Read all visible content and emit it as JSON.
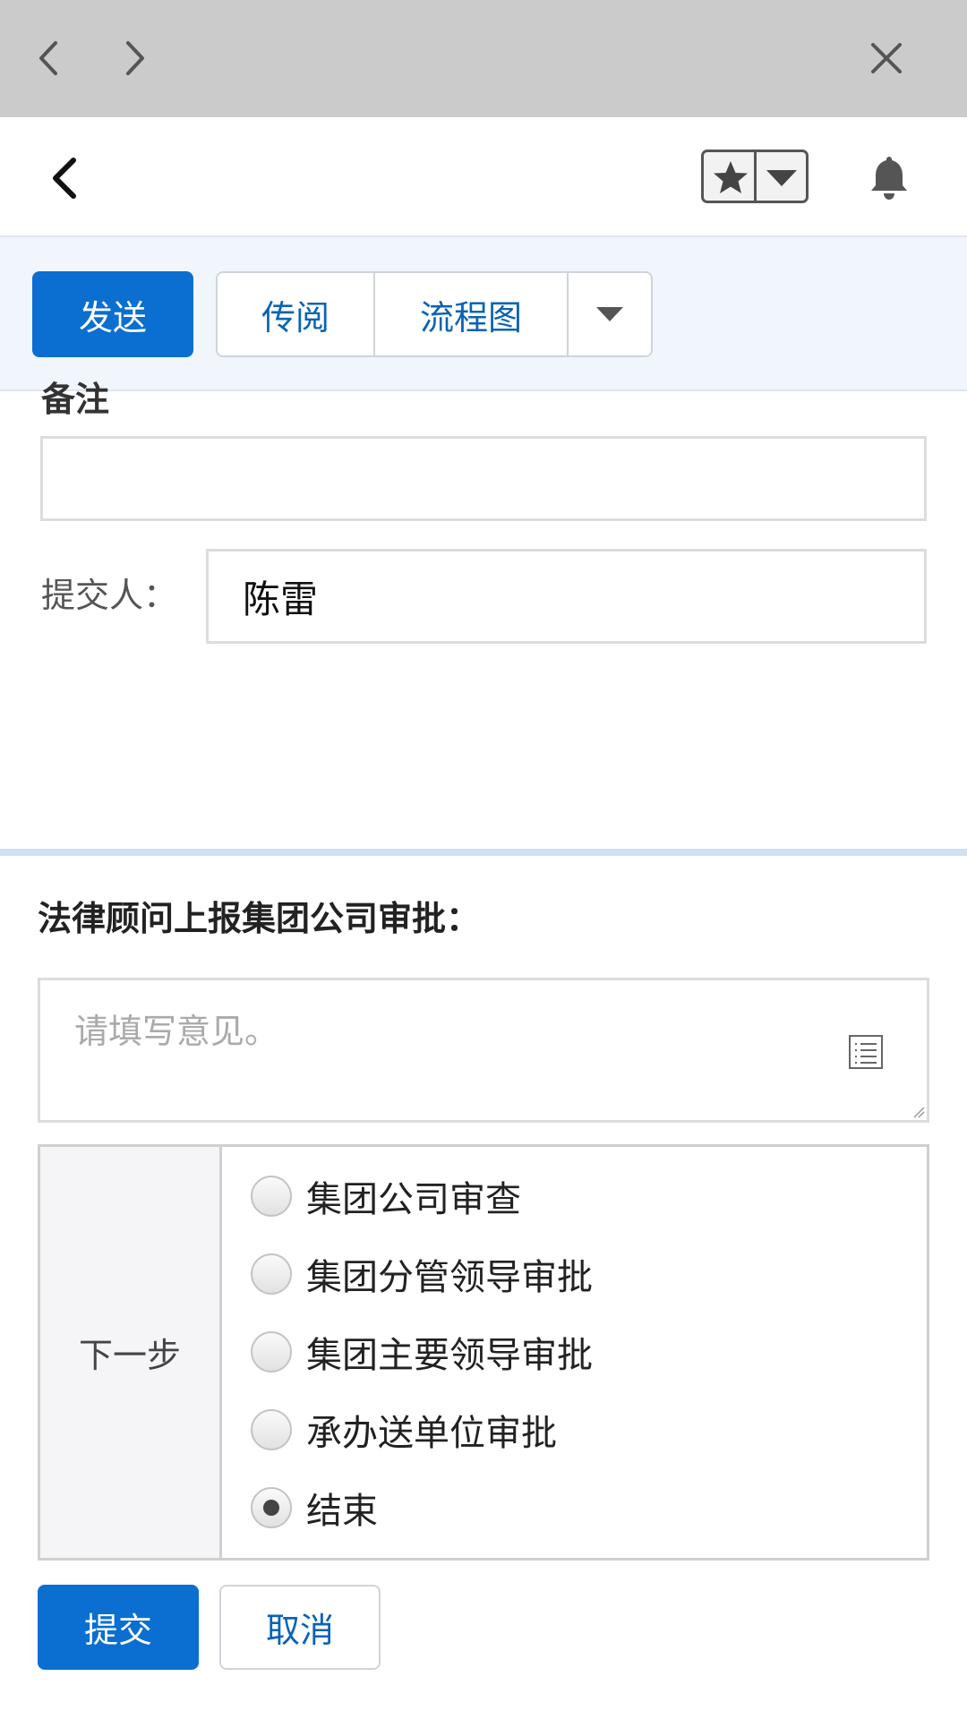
{
  "toolbar": {
    "send_label": "发送",
    "circulate_label": "传阅",
    "flowchart_label": "流程图"
  },
  "form": {
    "remark_label": "备注",
    "remark_value": "",
    "submitter_label": "提交人：",
    "submitter_value": "陈雷"
  },
  "approval": {
    "title": "法律顾问上报集团公司审批：",
    "opinion_placeholder": "请填写意见。",
    "next_step_label": "下一步",
    "options": [
      {
        "label": "集团公司审查",
        "checked": false
      },
      {
        "label": "集团分管领导审批",
        "checked": false
      },
      {
        "label": "集团主要领导审批",
        "checked": false
      },
      {
        "label": "承办送单位审批",
        "checked": false
      },
      {
        "label": "结束",
        "checked": true
      }
    ]
  },
  "actions": {
    "submit_label": "提交",
    "cancel_label": "取消"
  },
  "icons": {
    "nav_back": "chevron-left-icon",
    "nav_forward": "chevron-right-icon",
    "close": "close-icon",
    "page_back": "back-icon",
    "favorite": "star-icon",
    "favorite_dropdown": "caret-down-icon",
    "notifications": "bell-icon",
    "more": "caret-down-icon",
    "common_phrases": "list-icon"
  },
  "colors": {
    "primary": "#0a6fd1",
    "link": "#0a63b4",
    "topbar": "#cbcbcb",
    "toolbar_bg": "#f1f6fc",
    "separator": "#cfe0f6"
  }
}
